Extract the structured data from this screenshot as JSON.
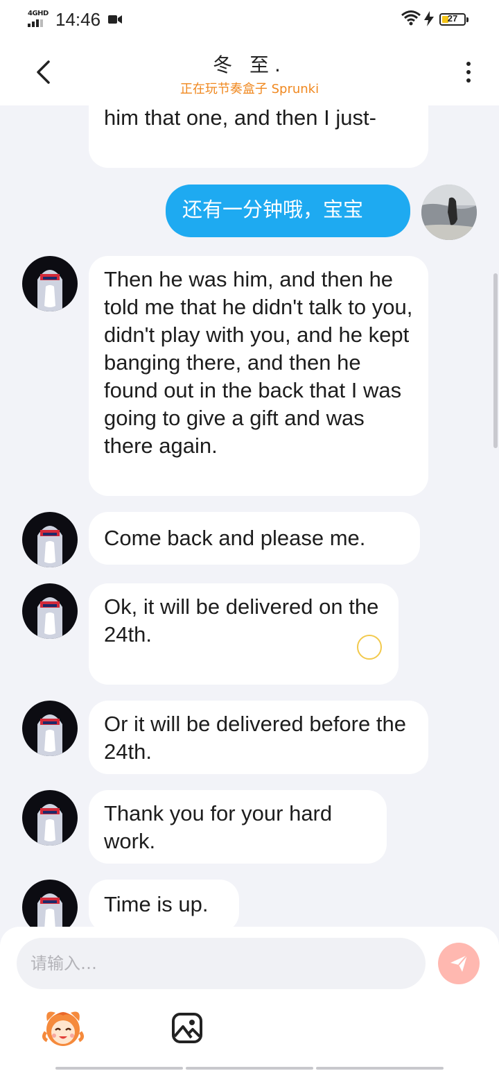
{
  "status_bar": {
    "network": "4GHD",
    "time": "14:46",
    "battery": "27"
  },
  "header": {
    "title": "冬 至.",
    "subtitle": "正在玩节奏盒子 Sprunki"
  },
  "messages": [
    {
      "side": "left",
      "text": "him that one, and then I just-"
    },
    {
      "side": "right",
      "text": "还有一分钟哦，宝宝"
    },
    {
      "side": "left",
      "text": "Then he was him, and then he told me that he didn't talk to you, didn't play with you, and he kept banging there, and then he found out in the back that I was going to give a gift and was there again."
    },
    {
      "side": "left",
      "text": "Come back and please me."
    },
    {
      "side": "left",
      "text": "Ok, it will be delivered on the 24th."
    },
    {
      "side": "left",
      "text": "Or it will be delivered before the 24th."
    },
    {
      "side": "left",
      "text": "Thank you for your hard work."
    },
    {
      "side": "left",
      "text": "Time is up."
    }
  ],
  "composer": {
    "placeholder": "请输入…"
  },
  "icons": {
    "back": "chevron-left-icon",
    "more": "more-vertical-icon",
    "send": "paper-plane-icon",
    "emoji": "mascot-emoji-icon",
    "image": "image-icon"
  },
  "colors": {
    "accent": "#1eaaf1",
    "subtitle": "#f0881f",
    "send_button": "#ffb8b0",
    "background": "#f2f3f8"
  }
}
